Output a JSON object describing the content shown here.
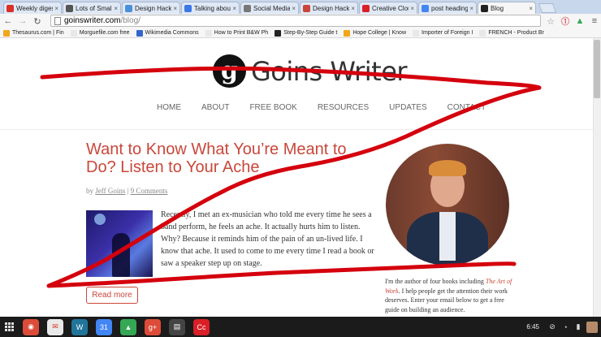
{
  "browser": {
    "tabs": [
      {
        "label": "Weekly digest",
        "color": "#d93025"
      },
      {
        "label": "Lots of Small...",
        "color": "#555555"
      },
      {
        "label": "Design Hacks...",
        "color": "#4a90d9"
      },
      {
        "label": "Talking about...",
        "color": "#3b78e7"
      },
      {
        "label": "Social Media...",
        "color": "#777777"
      },
      {
        "label": "Design Hacks",
        "color": "#c9473a"
      },
      {
        "label": "Creative Cloud",
        "color": "#da1f26"
      },
      {
        "label": "post heading",
        "color": "#4285f4"
      },
      {
        "label": "Blog",
        "color": "#222222",
        "active": true
      }
    ],
    "close_glyph": "×",
    "url_domain": "goinswriter.com",
    "url_path": "/blog/",
    "bookmarks": [
      {
        "label": "Thesaurus.com | Fin",
        "color": "#f2a71b"
      },
      {
        "label": "Morguefile.com free",
        "color": "#e8e8e8"
      },
      {
        "label": "Wikimedia Commons",
        "color": "#3366cc"
      },
      {
        "label": "How to Print B&W Ph",
        "color": "#e8e8e8"
      },
      {
        "label": "Step-By-Step Guide t",
        "color": "#222222"
      },
      {
        "label": "Hope College | Know",
        "color": "#f2a71b"
      },
      {
        "label": "Importer of Foreign I",
        "color": "#e8e8e8"
      },
      {
        "label": "FRENCH - Product Br",
        "color": "#e8e8e8"
      }
    ]
  },
  "site": {
    "logo_mark": "g",
    "logo_text": "Goins Writer",
    "nav": [
      "HOME",
      "ABOUT",
      "FREE BOOK",
      "RESOURCES",
      "UPDATES",
      "CONTACT"
    ],
    "post": {
      "title": "Want to Know What You’re Meant to Do? Listen to Your Ache",
      "byline_prefix": "by",
      "author": "Jeff Goins",
      "separator": "|",
      "comments": "9 Comments",
      "excerpt": "Recently, I met an ex-musician who told me every time he sees a band perform, he feels an ache. It actually hurts him to listen. Why? Because it reminds him of the pain of an un-lived life. I know that ache. It used to come to me every time I read a book or saw a speaker step up on stage.",
      "read_more": "Read more"
    },
    "bio": {
      "before": "I'm the author of four books including ",
      "link": "The Art of Work",
      "after": ". I help people get the attention their work deserves. Enter your email below to get a free guide on building an audience."
    }
  },
  "annotation": {
    "color": "#d4000d"
  },
  "taskbar": {
    "apps": [
      {
        "name": "chrome",
        "color": "#dd4b39",
        "glyph": "◉"
      },
      {
        "name": "gmail",
        "color": "#e9e9e9",
        "glyph": "✉"
      },
      {
        "name": "wordpress",
        "color": "#21759b",
        "glyph": "W"
      },
      {
        "name": "calendar",
        "color": "#4285f4",
        "glyph": "31"
      },
      {
        "name": "drive",
        "color": "#34a853",
        "glyph": "▲"
      },
      {
        "name": "google-plus",
        "color": "#dd4b39",
        "glyph": "g+"
      },
      {
        "name": "docs-app",
        "color": "#444444",
        "glyph": "▤"
      },
      {
        "name": "creative-cloud",
        "color": "#da1f26",
        "glyph": "Cc"
      }
    ],
    "time": "6:45"
  }
}
